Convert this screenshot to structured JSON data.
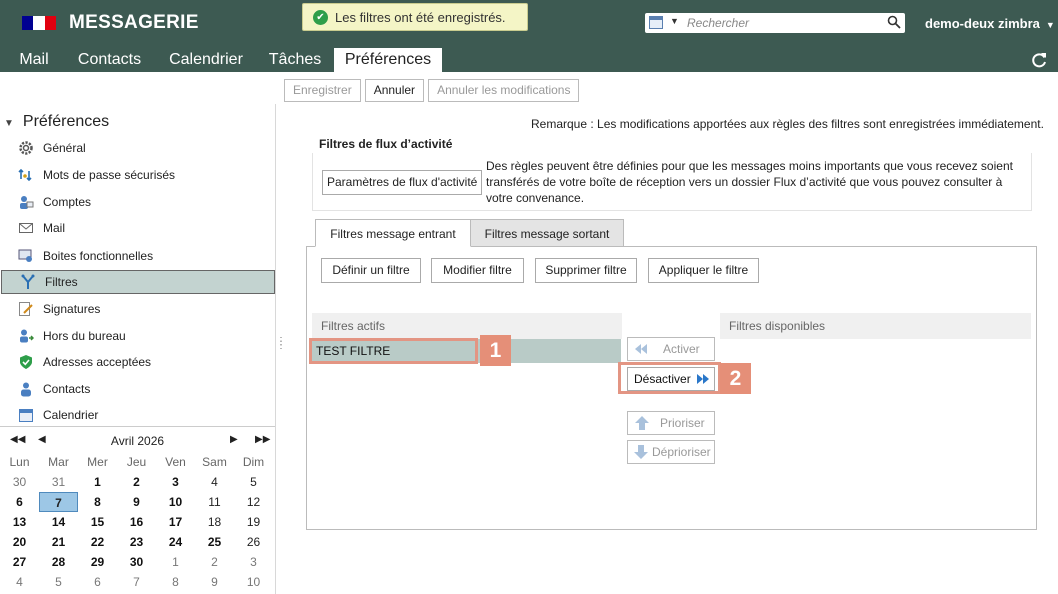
{
  "header": {
    "app_title": "MESSAGERIE",
    "toast": "Les filtres ont été enregistrés.",
    "search_placeholder": "Rechercher",
    "user": "demo-deux zimbra",
    "tabs": [
      "Mail",
      "Contacts",
      "Calendrier",
      "Tâches",
      "Préférences"
    ],
    "active_tab": "Préférences"
  },
  "toolbar": {
    "save": "Enregistrer",
    "cancel": "Annuler",
    "undo_changes": "Annuler les modifications"
  },
  "sidebar": {
    "title": "Préférences",
    "items": [
      {
        "label": "Général",
        "icon": "gear-icon"
      },
      {
        "label": "Mots de passe sécurisés",
        "icon": "key-arrows-icon"
      },
      {
        "label": "Comptes",
        "icon": "accounts-icon"
      },
      {
        "label": "Mail",
        "icon": "envelope-icon"
      },
      {
        "label": "Boites fonctionnelles",
        "icon": "shared-mailbox-icon"
      },
      {
        "label": "Filtres",
        "icon": "filter-icon"
      },
      {
        "label": "Signatures",
        "icon": "signature-pen-icon"
      },
      {
        "label": "Hors du bureau",
        "icon": "out-of-office-icon"
      },
      {
        "label": "Adresses acceptées",
        "icon": "shield-check-icon"
      },
      {
        "label": "Contacts",
        "icon": "contact-person-icon"
      },
      {
        "label": "Calendrier",
        "icon": "calendar-icon"
      }
    ],
    "selected": "Filtres"
  },
  "minical": {
    "month": "Avril 2026",
    "weekdays": [
      "Lun",
      "Mar",
      "Mer",
      "Jeu",
      "Ven",
      "Sam",
      "Dim"
    ],
    "weeks": [
      [
        "30",
        "31",
        "1",
        "2",
        "3",
        "4",
        "5"
      ],
      [
        "6",
        "7",
        "8",
        "9",
        "10",
        "11",
        "12"
      ],
      [
        "13",
        "14",
        "15",
        "16",
        "17",
        "18",
        "19"
      ],
      [
        "20",
        "21",
        "22",
        "23",
        "24",
        "25",
        "26"
      ],
      [
        "27",
        "28",
        "29",
        "30",
        "1",
        "2",
        "3"
      ],
      [
        "4",
        "5",
        "6",
        "7",
        "8",
        "9",
        "10"
      ]
    ],
    "today": "7"
  },
  "main": {
    "remark": "Remarque : Les modifications apportées aux règles des filtres sont enregistrées immédiatement.",
    "activity_title": "Filtres de flux d’activité",
    "activity_button": "Paramètres de flux d'activité",
    "activity_desc": "Des règles peuvent être définies pour que les messages moins importants que vous recevez soient transférés de votre boîte de réception vers un dossier Flux d’activité que vous pouvez consulter à votre convenance.",
    "filter_tabs": [
      "Filtres message entrant",
      "Filtres message sortant"
    ],
    "filter_buttons": [
      "Définir un filtre",
      "Modifier filtre",
      "Supprimer filtre",
      "Appliquer le filtre"
    ],
    "active_filters_header": "Filtres actifs",
    "available_filters_header": "Filtres disponibles",
    "active_filters": [
      "TEST FILTRE"
    ],
    "move_buttons": {
      "activate": "Activer",
      "deactivate": "Désactiver",
      "prioritize": "Prioriser",
      "deprioritize": "Déprioriser"
    },
    "badges": [
      "1",
      "2"
    ]
  }
}
